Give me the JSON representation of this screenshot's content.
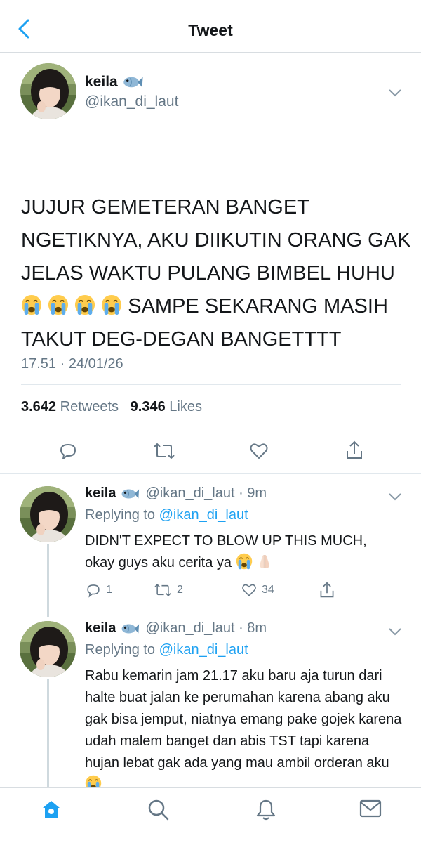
{
  "header": {
    "title": "Tweet"
  },
  "main_tweet": {
    "name": "keila",
    "handle": "@ikan_di_laut",
    "text_part1": "JUJUR GEMETERAN BANGET NGETIKNYA, AKU DIIKUTIN ORANG GAK JELAS WAKTU PULANG BIMBEL HUHU",
    "text_part2": "SAMPE SEKARANG MASIH TAKUT DEG-DEGAN BANGETTTT",
    "timestamp": "17.51 · 24/01/26",
    "retweets_count": "3.642",
    "retweets_label": "Retweets",
    "likes_count": "9.346",
    "likes_label": "Likes"
  },
  "replies": [
    {
      "name": "keila",
      "handle_time": "@ikan_di_laut · 9m",
      "replying_label": "Replying to",
      "replying_to": "@ikan_di_laut",
      "text": "DIDN'T EXPECT TO BLOW UP THIS MUCH, okay guys aku cerita ya",
      "reply_count": "1",
      "retweet_count": "2",
      "like_count": "34"
    },
    {
      "name": "keila",
      "handle_time": "@ikan_di_laut · 8m",
      "replying_label": "Replying to",
      "replying_to": "@ikan_di_laut",
      "text": "Rabu kemarin jam 21.17 aku baru aja turun dari halte buat jalan ke perumahan karena abang aku gak bisa jemput, niatnya emang pake gojek karena udah malem banget dan abis TST tapi karena hujan lebat gak ada yang mau ambil orderan aku"
    }
  ],
  "icons": {
    "back": "chevron-left-icon",
    "fish": "fish-emoji-icon",
    "crying": "crying-face-emoji-icon",
    "pray": "folded-hands-emoji-icon"
  },
  "colors": {
    "accent": "#1da1f2",
    "muted": "#657786",
    "text": "#14171a",
    "border": "#e1e8ed"
  }
}
